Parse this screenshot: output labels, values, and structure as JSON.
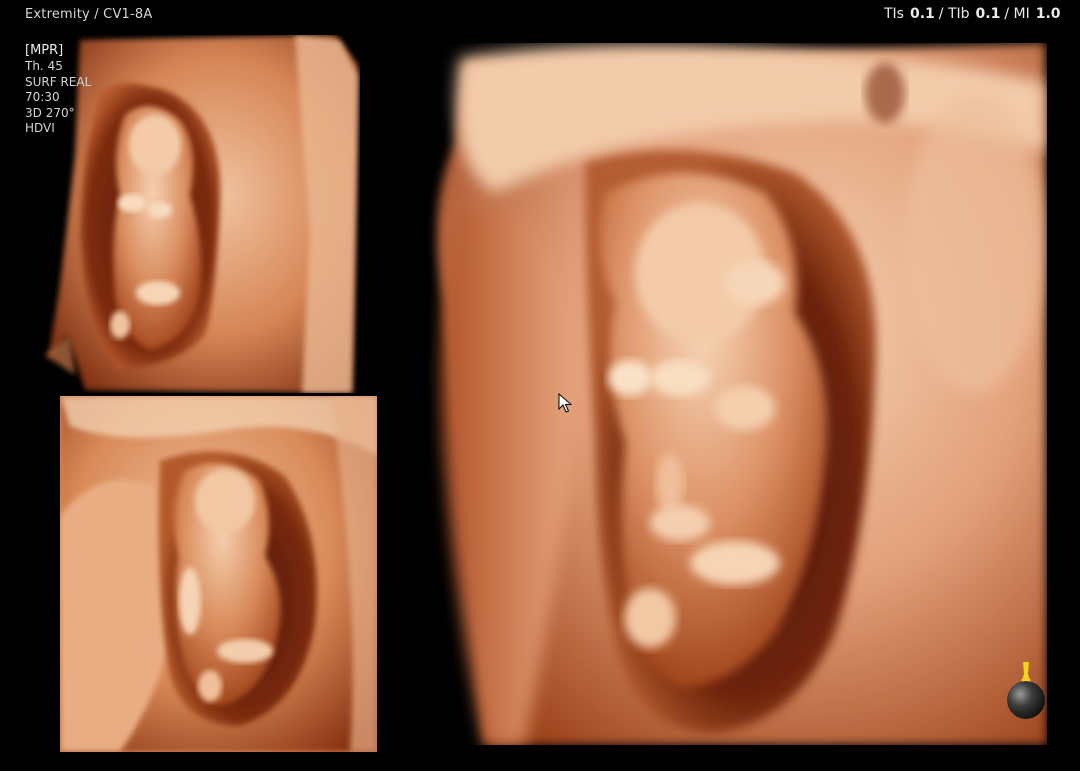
{
  "header": {
    "preset": "Extremity / CV1-8A",
    "tis_label": "TIs",
    "tis_value": "0.1",
    "tib_label": "TIb",
    "tib_value": "0.1",
    "mi_label": "MI",
    "mi_value": "1.0"
  },
  "info": {
    "mode": "[MPR]",
    "thickness": "Th. 45",
    "render": "SURF REAL",
    "ratio": "70:30",
    "rotation": "3D 270°",
    "hdvi": "HDVI"
  },
  "icons": {
    "cursor": "arrow-cursor-icon",
    "render_light": "light-source-icon"
  },
  "colors": {
    "background": "#000000",
    "tissue_light": "#f2c9a8",
    "tissue_mid": "#d98a5a",
    "tissue_dark": "#8a3412"
  }
}
